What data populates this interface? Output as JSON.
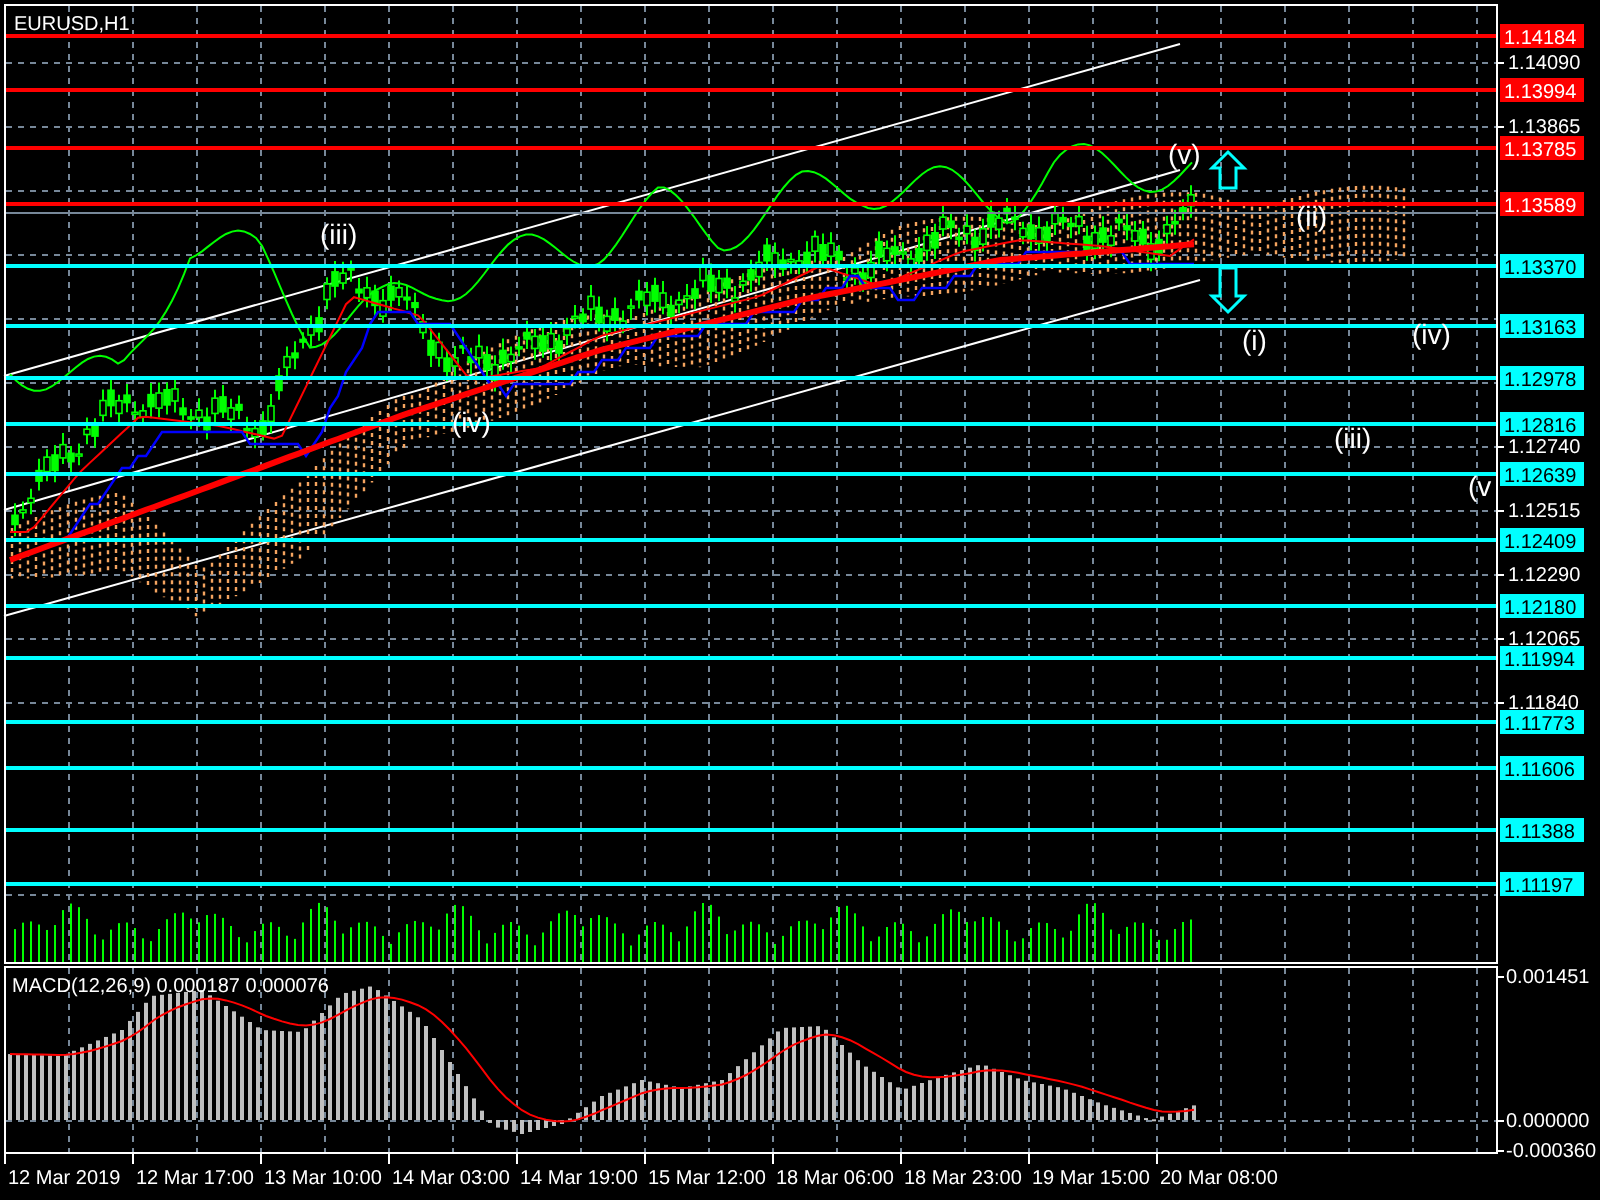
{
  "chart": {
    "title": "EURUSD,H1",
    "levels": [
      {
        "price": "1.14184",
        "color": "#ff0000"
      },
      {
        "price": "1.13994",
        "color": "#ff0000"
      },
      {
        "price": "1.13785",
        "color": "#ff0000"
      },
      {
        "price": "1.13589",
        "color": "#ff0000"
      },
      {
        "price": "1.13370",
        "color": "#00ffff"
      },
      {
        "price": "1.13163",
        "color": "#00ffff"
      },
      {
        "price": "1.12978",
        "color": "#00ffff"
      },
      {
        "price": "1.12816",
        "color": "#00ffff"
      },
      {
        "price": "1.12639",
        "color": "#00ffff"
      },
      {
        "price": "1.12409",
        "color": "#00ffff"
      },
      {
        "price": "1.12180",
        "color": "#00ffff"
      },
      {
        "price": "1.11994",
        "color": "#00ffff"
      },
      {
        "price": "1.11773",
        "color": "#00ffff"
      },
      {
        "price": "1.11606",
        "color": "#00ffff"
      },
      {
        "price": "1.11388",
        "color": "#00ffff"
      },
      {
        "price": "1.11197",
        "color": "#00ffff"
      }
    ],
    "price_ticks": [
      "1.14090",
      "1.13865",
      "1.12740",
      "1.12515",
      "1.12290",
      "1.12065",
      "1.11840"
    ],
    "wave_labels": [
      "(iii)",
      "(iv)",
      "(v)",
      "(ii)",
      "(i)",
      "(iv)",
      "(iii)",
      "(v"
    ]
  },
  "macd": {
    "title": "MACD(12,26,9) 0.000187 0.000076",
    "ticks": [
      "0.001451",
      "0.000000",
      "-0.000360"
    ]
  },
  "time_axis": {
    "labels": [
      "12 Mar 2019",
      "12 Mar 17:00",
      "13 Mar 10:00",
      "14 Mar 03:00",
      "14 Mar 19:00",
      "15 Mar 12:00",
      "18 Mar 06:00",
      "18 Mar 23:00",
      "19 Mar 15:00",
      "20 Mar 08:00"
    ]
  }
}
